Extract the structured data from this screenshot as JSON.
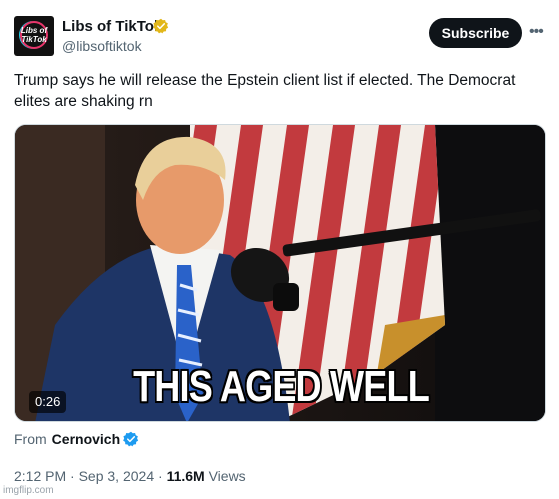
{
  "account": {
    "display_name": "Libs of TikTok",
    "handle": "@libsoftiktok",
    "avatar_text": "Libs of\nTikTok",
    "verified_color": "#e2b719"
  },
  "header": {
    "subscribe_label": "Subscribe",
    "more_label": "•••"
  },
  "tweet": {
    "text": "Trump says he will release the Epstein client list if elected. The Democrat elites are shaking rn"
  },
  "media": {
    "caption": "THIS AGED WELL",
    "duration": "0:26"
  },
  "source": {
    "prefix": "From",
    "name": "Cernovich",
    "verified_color": "#1d9bf0"
  },
  "meta": {
    "time": "2:12 PM",
    "separator": "·",
    "date": "Sep 3, 2024",
    "views_count": "11.6M",
    "views_label": "Views"
  },
  "watermark": "imgflip.com"
}
